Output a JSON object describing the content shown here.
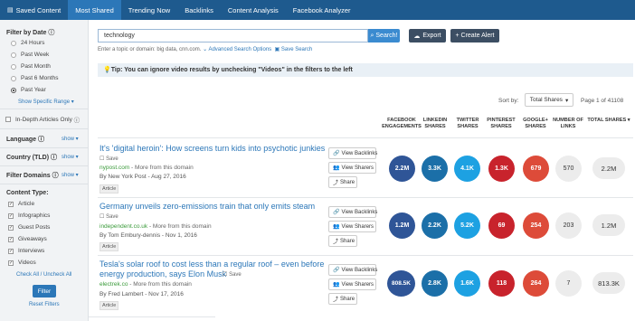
{
  "nav": {
    "items": [
      {
        "label": "Saved Content",
        "icon": "folder-icon"
      },
      {
        "label": "Most Shared"
      },
      {
        "label": "Trending Now"
      },
      {
        "label": "Backlinks"
      },
      {
        "label": "Content Analysis"
      },
      {
        "label": "Facebook Analyzer"
      }
    ],
    "active_index": 1
  },
  "sidebar": {
    "filter_by_date_title": "Filter by Date",
    "date_options": [
      "24 Hours",
      "Past Week",
      "Past Month",
      "Past 6 Months",
      "Past Year"
    ],
    "selected_date": "Past Year",
    "show_specific_range": "Show Specific Range ▾",
    "in_depth_label": "In-Depth Articles Only",
    "language_label": "Language",
    "country_label": "Country (TLD)",
    "filter_domains_label": "Filter Domains",
    "show_link": "show ▾",
    "content_type_title": "Content Type:",
    "content_types": [
      "Article",
      "Infographics",
      "Guest Posts",
      "Giveaways",
      "Interviews",
      "Videos"
    ],
    "check_all": "Check All / Uncheck All",
    "filter_button": "Filter",
    "reset_filters": "Reset Filters"
  },
  "search": {
    "value": "technology",
    "button": "Search!",
    "hint": "Enter a topic or domain: big data, cnn.com.",
    "advanced": "Advanced Search Options",
    "save_search": "Save Search",
    "export_label": "Export",
    "create_alert_label": "+ Create Alert"
  },
  "tip": "Tip: You can ignore video results by unchecking \"Videos\" in the filters to the left",
  "sort": {
    "label": "Sort by:",
    "value": "Total Shares",
    "page_info": "Page 1 of 41108"
  },
  "columns": {
    "facebook": [
      "FACEBOOK",
      "ENGAGEMENTS"
    ],
    "linkedin": [
      "LINKEDIN",
      "SHARES"
    ],
    "twitter": [
      "TWITTER",
      "SHARES"
    ],
    "pinterest": [
      "PINTEREST",
      "SHARES"
    ],
    "googleplus": [
      "GOOGLE+",
      "SHARES"
    ],
    "links": [
      "NUMBER OF",
      "LINKS"
    ],
    "total": [
      "TOTAL SHARES ▾"
    ]
  },
  "actions": {
    "view_backlinks": "View Backlinks",
    "view_sharers": "View Sharers",
    "share": "Share",
    "save": "Save",
    "more_from_domain": " - More from this domain"
  },
  "articles": [
    {
      "title": "It's 'digital heroin': How screens turn kids into psychotic junkies",
      "domain": "nypost.com",
      "byline": "By New York Post - Aug 27, 2016",
      "type": "Article",
      "facebook": "2.2M",
      "linkedin": "3.3K",
      "twitter": "4.1K",
      "pinterest": "1.3K",
      "googleplus": "679",
      "links": "570",
      "total": "2.2M"
    },
    {
      "title": "Germany unveils zero-emissions train that only emits steam",
      "domain": "independent.co.uk",
      "byline": "By Tom Embury-dennis - Nov 1, 2016",
      "type": "Article",
      "facebook": "1.2M",
      "linkedin": "2.2K",
      "twitter": "5.2K",
      "pinterest": "69",
      "googleplus": "254",
      "links": "203",
      "total": "1.2M"
    },
    {
      "title_line1": "Tesla's solar roof to cost less than a regular roof – even before",
      "title_line2": "energy production, says Elon Musk",
      "domain": "electrek.co",
      "byline": "By Fred Lambert - Nov 17, 2016",
      "type": "Article",
      "facebook": "808.5K",
      "linkedin": "2.8K",
      "twitter": "1.6K",
      "pinterest": "118",
      "googleplus": "264",
      "links": "7",
      "total": "813.3K"
    }
  ]
}
